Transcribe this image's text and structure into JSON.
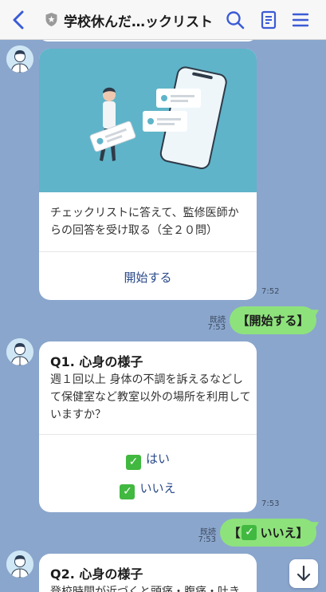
{
  "header": {
    "title": "学校休んだ…ックリスト",
    "icons": [
      "back-icon",
      "shield-icon",
      "search-icon",
      "note-icon",
      "menu-icon"
    ]
  },
  "card1": {
    "description": "チェックリストに答えて、監修医師からの回答を受け取る（全２０問）",
    "action": "開始する",
    "time": "7:52"
  },
  "msg1": {
    "read": "既読",
    "time": "7:53",
    "text": "【開始する】"
  },
  "q1": {
    "title": "Q1. 心身の様子",
    "body": "週１回以上 身体の不調を訴えるなどして保健室など教室以外の場所を利用していますか？",
    "option_yes": "はい",
    "option_no": "いいえ",
    "time": "7:53"
  },
  "msg2": {
    "read": "既読",
    "time": "7:53",
    "text_open": "【",
    "text_label": "いいえ",
    "text_close": "】"
  },
  "q2": {
    "title": "Q2. 心身の様子",
    "body_partial": "登校時間が近づくと頭痛・腹痛・吐き"
  },
  "colors": {
    "chat_background": "#8aa6cd",
    "own_bubble": "#8ee27c",
    "accent": "#3b5bd6",
    "check": "#41b840"
  }
}
